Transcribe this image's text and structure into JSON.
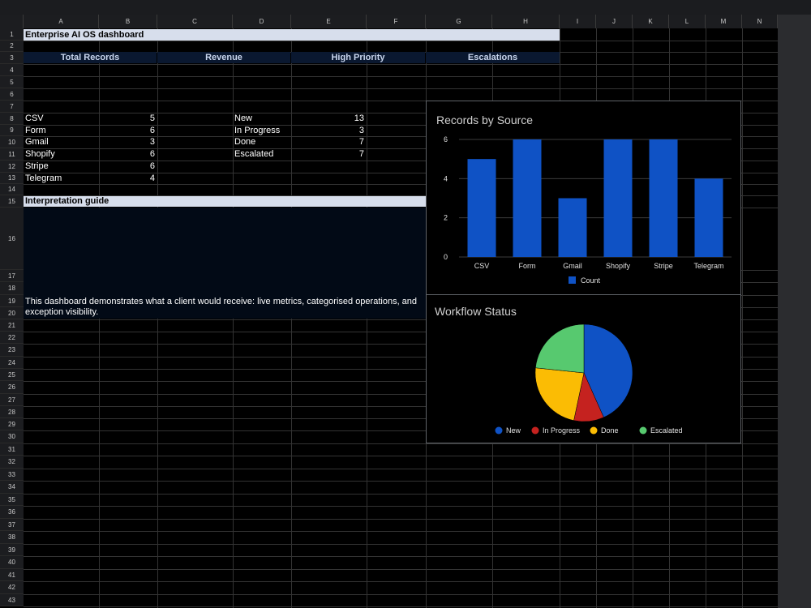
{
  "columns": [
    "A",
    "B",
    "C",
    "D",
    "E",
    "F",
    "G",
    "H",
    "I",
    "J",
    "K",
    "L",
    "M",
    "N"
  ],
  "rows": [
    "1",
    "2",
    "3",
    "4",
    "5",
    "6",
    "7",
    "8",
    "9",
    "10",
    "11",
    "12",
    "13",
    "14",
    "15",
    "16",
    "17",
    "18",
    "19",
    "20",
    "21",
    "22",
    "23",
    "24",
    "25",
    "26",
    "27",
    "28",
    "29",
    "30",
    "31",
    "32",
    "33",
    "34",
    "35",
    "36",
    "37",
    "38",
    "39",
    "40",
    "41",
    "42",
    "43"
  ],
  "title": "Enterprise AI OS dashboard",
  "kpis": {
    "total_records": "Total Records",
    "revenue": "Revenue",
    "high_priority": "High Priority",
    "escalations": "Escalations"
  },
  "sources": [
    {
      "label": "CSV",
      "value": "5"
    },
    {
      "label": "Form",
      "value": "6"
    },
    {
      "label": "Gmail",
      "value": "3"
    },
    {
      "label": "Shopify",
      "value": "6"
    },
    {
      "label": "Stripe",
      "value": "6"
    },
    {
      "label": "Telegram",
      "value": "4"
    }
  ],
  "statuses": [
    {
      "label": "New",
      "value": "13"
    },
    {
      "label": "In Progress",
      "value": "3"
    },
    {
      "label": "Done",
      "value": "7"
    },
    {
      "label": "Escalated",
      "value": "7"
    }
  ],
  "guide": {
    "title": "Interpretation guide",
    "line1": "This dashboard demonstrates what a client would receive: live metrics, categorised operations, and",
    "line2": "exception visibility."
  },
  "chart_data": [
    {
      "type": "bar",
      "title": "Records by Source",
      "categories": [
        "CSV",
        "Form",
        "Gmail",
        "Shopify",
        "Stripe",
        "Telegram"
      ],
      "series": [
        {
          "name": "Count",
          "values": [
            5,
            6,
            3,
            6,
            6,
            4
          ]
        }
      ],
      "ylim": [
        0,
        6
      ],
      "yticks": [
        "0",
        "2",
        "4",
        "6"
      ],
      "grid": true,
      "legend": "bottom",
      "color": "#0f52c5"
    },
    {
      "type": "pie",
      "title": "Workflow Status",
      "labels": [
        "New",
        "In Progress",
        "Done",
        "Escalated"
      ],
      "values": [
        13,
        3,
        7,
        7
      ],
      "colors": [
        "#0f52c5",
        "#c5221f",
        "#fbbc04",
        "#57c96f"
      ],
      "legend": "bottom"
    }
  ]
}
